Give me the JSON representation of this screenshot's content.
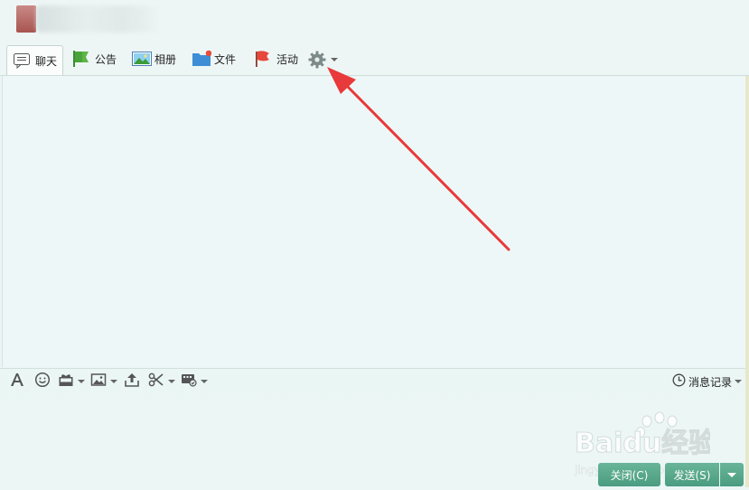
{
  "toolbar": {
    "tabs": [
      {
        "label": "聊天",
        "icon": "chat-bubble-icon"
      },
      {
        "label": "公告",
        "icon": "megaphone-flag-icon"
      },
      {
        "label": "相册",
        "icon": "photo-album-icon"
      },
      {
        "label": "文件",
        "icon": "folder-icon"
      },
      {
        "label": "活动",
        "icon": "red-flag-icon"
      }
    ],
    "settings_icon": "gear-icon"
  },
  "input_toolbar": {
    "items": [
      "font-icon",
      "emoji-icon",
      "gift-icon",
      "image-icon",
      "upload-icon",
      "scissors-icon",
      "screen-icon"
    ],
    "history_label": "消息记录"
  },
  "footer": {
    "close_label": "关闭(C)",
    "send_label": "发送(S)"
  },
  "watermark": {
    "brand": "Baidu",
    "cn": "经验",
    "url": "jingyan.baidu.com"
  },
  "colors": {
    "accent_button": "#4a9c80",
    "annotation_arrow": "#e8393b",
    "background": "#eaf5f3"
  }
}
